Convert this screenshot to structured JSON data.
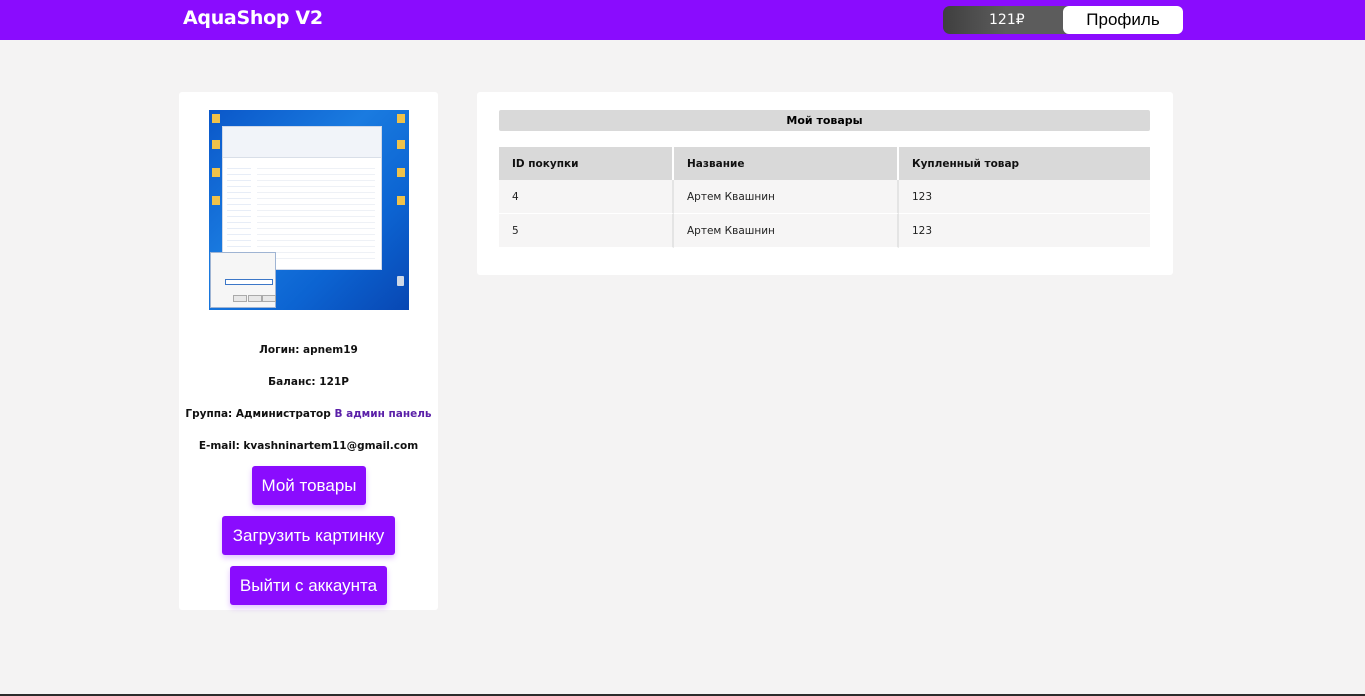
{
  "header": {
    "logo": "AquaShop V2",
    "balance": "121₽",
    "profile_label": "Профиль"
  },
  "profile": {
    "avatar_icon": "uploaded-screenshot-image",
    "login": "Логин: apnem19",
    "balance": "Баланс: 121Р",
    "group_prefix": "Группа: Администратор",
    "admin_link": "В админ панель",
    "email": "E-mail: kvashninartem11@gmail.com",
    "buttons": {
      "my_items": "Мой товары",
      "upload": "Загрузить картинку",
      "logout": "Выйти с аккаунта"
    }
  },
  "items": {
    "title": "Мой товары",
    "columns": [
      "ID покупки",
      "Название",
      "Купленный товар"
    ],
    "rows": [
      [
        "4",
        "Артем Квашнин",
        "123"
      ],
      [
        "5",
        "Артем Квашнин",
        "123"
      ]
    ]
  },
  "colors": {
    "accent": "#8a0cfe",
    "background": "#f4f3f3",
    "link": "#5a1fa8"
  }
}
